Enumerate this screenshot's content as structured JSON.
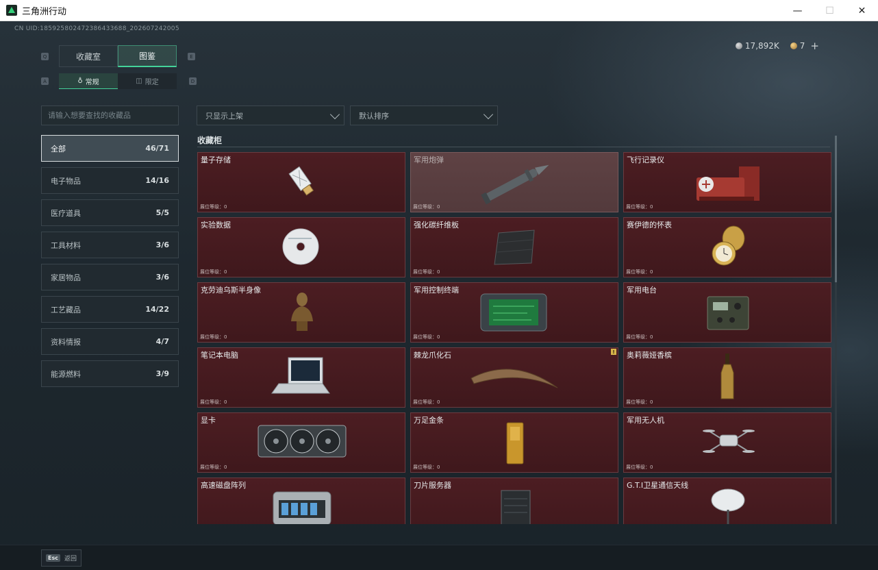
{
  "window": {
    "title": "三角洲行动",
    "minimize": "—",
    "maximize": "☐",
    "close": "✕"
  },
  "uid": "CN UID:1859258024723864336​88_202607242005",
  "currency": {
    "silver": "17,892K",
    "gold": "7",
    "add": "+"
  },
  "tabs_main": [
    {
      "label": "收藏室"
    },
    {
      "label": "图鉴"
    }
  ],
  "tabs_sub": [
    {
      "label": "常规",
      "icon": "♁"
    },
    {
      "label": "限定",
      "icon": "◫"
    }
  ],
  "keyhints": {
    "q": "Q",
    "e": "E",
    "a": "A",
    "d": "D"
  },
  "search": {
    "placeholder": "请输入想要查找的收藏品"
  },
  "filters": {
    "shelf": "只显示上架",
    "sort": "默认排序"
  },
  "categories": [
    {
      "label": "全部",
      "count": "46/71"
    },
    {
      "label": "电子物品",
      "count": "14/16"
    },
    {
      "label": "医疗道具",
      "count": "5/5"
    },
    {
      "label": "工具材料",
      "count": "3/6"
    },
    {
      "label": "家居物品",
      "count": "3/6"
    },
    {
      "label": "工艺藏品",
      "count": "14/22"
    },
    {
      "label": "资料情报",
      "count": "4/7"
    },
    {
      "label": "能源燃料",
      "count": "3/9"
    }
  ],
  "section_title": "收藏柜",
  "items": [
    {
      "name": "量子存储",
      "level": "展位等级：0",
      "icon": "usb-drive-icon"
    },
    {
      "name": "军用炮弹",
      "level": "展位等级：0",
      "icon": "artillery-shell-icon"
    },
    {
      "name": "飞行记录仪",
      "level": "展位等级：0",
      "icon": "flight-recorder-icon"
    },
    {
      "name": "实验数据",
      "level": "展位等级：0",
      "icon": "disc-icon"
    },
    {
      "name": "强化碳纤维板",
      "level": "展位等级：0",
      "icon": "carbon-plate-icon"
    },
    {
      "name": "赛伊德的怀表",
      "level": "展位等级：0",
      "icon": "pocket-watch-icon"
    },
    {
      "name": "克劳迪乌斯半身像",
      "level": "展位等级：0",
      "icon": "bust-icon"
    },
    {
      "name": "军用控制终端",
      "level": "展位等级：0",
      "icon": "control-terminal-icon"
    },
    {
      "name": "军用电台",
      "level": "展位等级：0",
      "icon": "radio-icon"
    },
    {
      "name": "笔记本电脑",
      "level": "展位等级：0",
      "icon": "laptop-icon"
    },
    {
      "name": "棘龙爪化石",
      "level": "展位等级：0",
      "icon": "claw-fossil-icon",
      "badge": "!"
    },
    {
      "name": "奥莉薇娅香槟",
      "level": "展位等级：0",
      "icon": "champagne-icon"
    },
    {
      "name": "显卡",
      "level": "展位等级：0",
      "icon": "graphics-card-icon"
    },
    {
      "name": "万足金条",
      "level": "展位等级：0",
      "icon": "gold-bar-icon"
    },
    {
      "name": "军用无人机",
      "level": "展位等级：0",
      "icon": "drone-icon"
    },
    {
      "name": "高速磁盘阵列",
      "level": "",
      "icon": "disk-array-icon"
    },
    {
      "name": "刀片服务器",
      "level": "",
      "icon": "blade-server-icon"
    },
    {
      "name": "G.T.I卫星通信天线",
      "level": "",
      "icon": "satellite-dish-icon"
    }
  ],
  "footer": {
    "esc_key": "Esc",
    "esc_label": "返回"
  }
}
